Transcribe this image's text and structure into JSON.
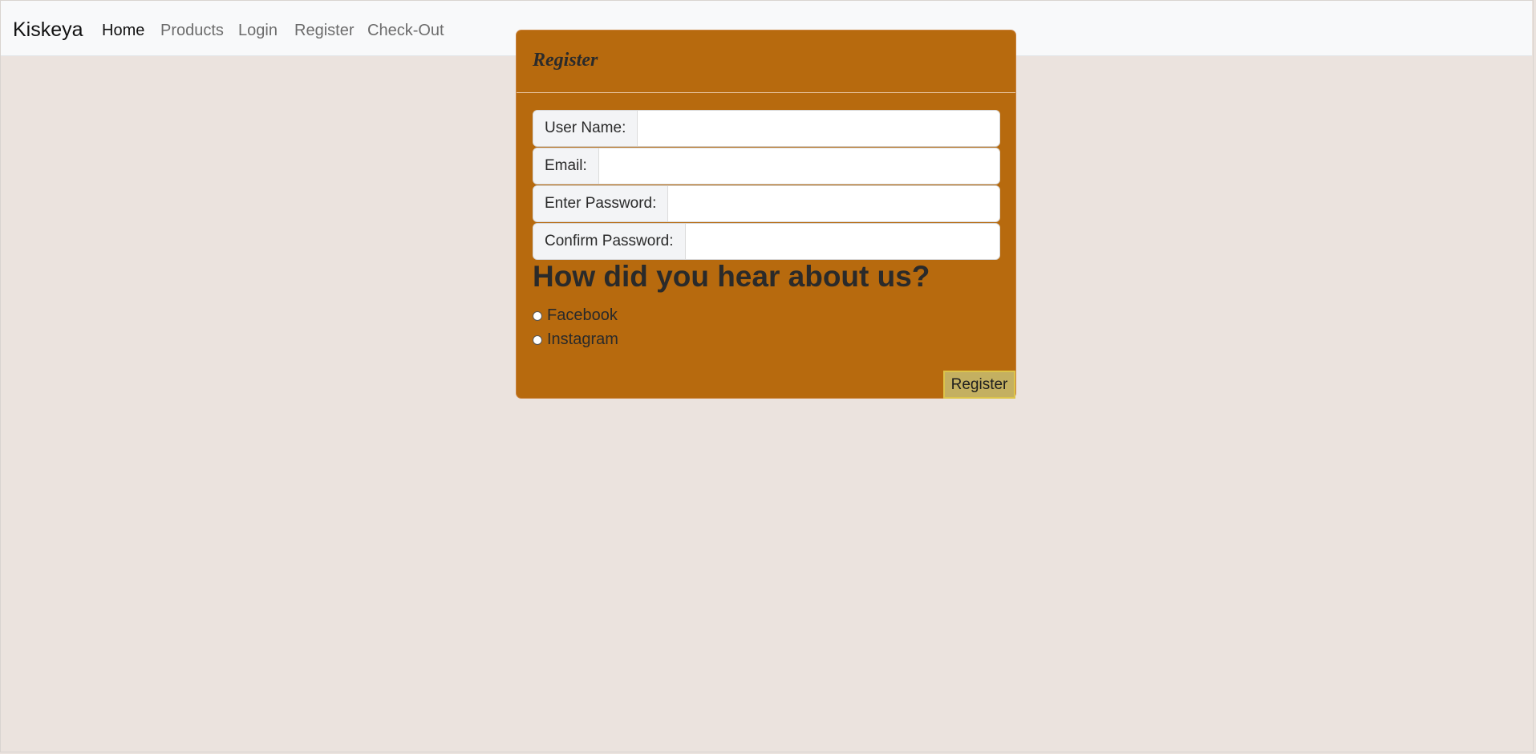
{
  "navbar": {
    "brand": "Kiskeya",
    "links": [
      "Home",
      "Products",
      "Login",
      "Register",
      "Check-Out"
    ],
    "active": "Home"
  },
  "register_card": {
    "title": "Register",
    "fields": [
      {
        "label": "User Name:",
        "value": ""
      },
      {
        "label": "Email:",
        "value": ""
      },
      {
        "label": "Enter Password:",
        "value": ""
      },
      {
        "label": "Confirm Password:",
        "value": ""
      }
    ],
    "question": "How did you hear about us?",
    "options": [
      "Facebook",
      "Instagram"
    ],
    "submit_label": "Register"
  },
  "colors": {
    "page_background": "#ebe3de",
    "card_background": "#b76a0e",
    "button_background": "#c4b061"
  }
}
